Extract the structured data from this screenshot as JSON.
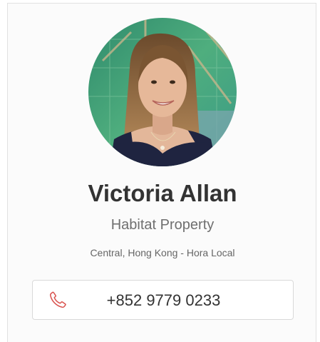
{
  "agent": {
    "name": "Victoria Allan",
    "company": "Habitat Property",
    "location": "Central, Hong Kong - Hora Local",
    "phone": "+852 9779 0233"
  },
  "icons": {
    "avatar": "profile-photo",
    "phone": "phone-icon"
  },
  "colors": {
    "name_text": "#333333",
    "secondary_text": "#6f6f6f",
    "phone_icon": "#d9534f",
    "card_border": "#e1e1e1"
  }
}
